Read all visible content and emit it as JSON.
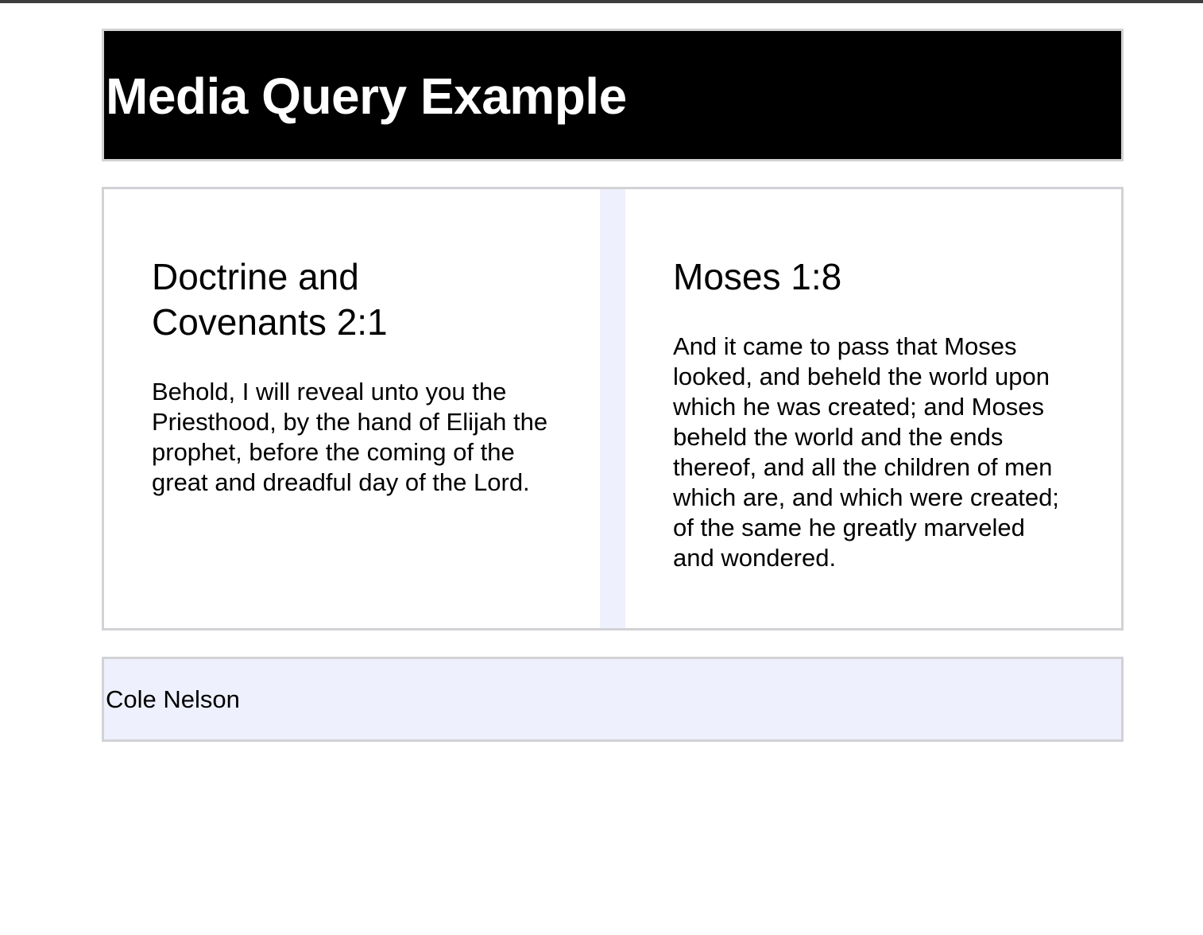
{
  "colors": {
    "header_background": "#000000",
    "header_text": "#ffffff",
    "gutter_and_footer": "#eef0fd",
    "border": "#d2d2d6"
  },
  "header": {
    "title": "Media Query Example"
  },
  "cards": [
    {
      "title": "Doctrine and Covenants 2:1",
      "text": "Behold, I will reveal unto you the Priesthood, by the hand of Elijah the prophet, before the coming of the great and dreadful day of the Lord."
    },
    {
      "title": "Moses 1:8",
      "text": "And it came to pass that Moses looked, and beheld the world upon which he was created; and Moses beheld the world and the ends thereof, and all the children of men which are, and which were created; of the same he greatly marveled and wondered."
    }
  ],
  "footer": {
    "author": "Cole Nelson"
  }
}
